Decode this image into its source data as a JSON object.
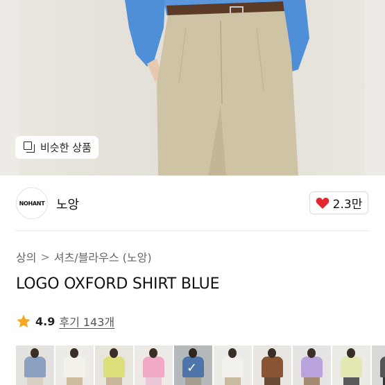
{
  "hero": {
    "similar_button": {
      "label": "비슷한 상품",
      "icon": "similar-items-icon"
    }
  },
  "brand": {
    "logo_text": "NOHANT",
    "name": "노앙"
  },
  "like": {
    "icon": "heart-icon",
    "count": "2.3만",
    "color": "#e5252f"
  },
  "breadcrumb": {
    "items": [
      "상의",
      "셔츠/블라우스 (노앙)"
    ],
    "separator": ">"
  },
  "product": {
    "title": "LOGO OXFORD SHIRT BLUE"
  },
  "rating": {
    "icon": "star-icon",
    "score": "4.9",
    "reviews": "후기 143개",
    "star_color": "#f5a623"
  },
  "thumbnails": [
    {
      "bg": "#e4e2de",
      "top": "#8aa1c2",
      "bottom": "#d6cfc2",
      "selected": false
    },
    {
      "bg": "#ecebe7",
      "top": "#f3f1ea",
      "bottom": "#cdbd9e",
      "selected": false
    },
    {
      "bg": "#e8e5dc",
      "top": "#dde07a",
      "bottom": "#c9b79a",
      "selected": false
    },
    {
      "bg": "#ece9e6",
      "top": "#f0a9c4",
      "bottom": "#e9c7d7",
      "selected": false
    },
    {
      "bg": "#dfe2e6",
      "top": "#5f8fd0",
      "bottom": "#c9c0ae",
      "selected": true
    },
    {
      "bg": "#ecebe8",
      "top": "#f2f1ee",
      "bottom": "#c7ba9e",
      "selected": false
    },
    {
      "bg": "#e9e6e1",
      "top": "#8a5434",
      "bottom": "#6b4a35",
      "selected": false
    },
    {
      "bg": "#e6e4e2",
      "top": "#b8a3dc",
      "bottom": "#a58a73",
      "selected": false
    },
    {
      "bg": "#eceae5",
      "top": "#e3e8b2",
      "bottom": "#5a5a5a",
      "selected": false
    },
    {
      "bg": "#d9d9d9",
      "top": "#555555",
      "bottom": "#333333",
      "selected": false
    }
  ]
}
